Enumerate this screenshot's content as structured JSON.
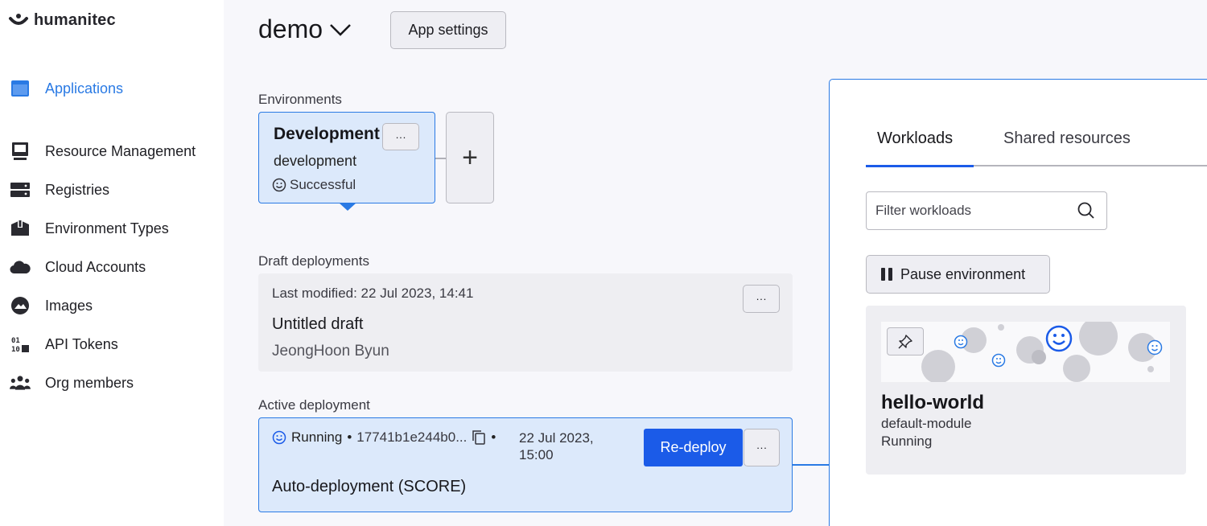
{
  "brand": {
    "name": "humanitec"
  },
  "sidebar": {
    "items": [
      {
        "label": "Applications",
        "icon": "applications-icon",
        "active": true
      },
      {
        "label": "Resource Management",
        "icon": "monitor-icon"
      },
      {
        "label": "Registries",
        "icon": "server-icon"
      },
      {
        "label": "Environment Types",
        "icon": "box-icon"
      },
      {
        "label": "Cloud Accounts",
        "icon": "cloud-icon"
      },
      {
        "label": "Images",
        "icon": "image-icon"
      },
      {
        "label": "API Tokens",
        "icon": "binary-icon"
      },
      {
        "label": "Org members",
        "icon": "people-icon"
      }
    ]
  },
  "header": {
    "app_name": "demo",
    "app_settings_label": "App settings"
  },
  "environments": {
    "label": "Environments",
    "card": {
      "name": "Development",
      "slug": "development",
      "status": "Successful",
      "more_label": "···"
    },
    "add_label": "+"
  },
  "draft": {
    "label": "Draft deployments",
    "last_modified": "Last modified: 22 Jul 2023, 14:41",
    "title": "Untitled draft",
    "author": "JeongHoon Byun",
    "more_label": "···"
  },
  "active": {
    "label": "Active deployment",
    "status": "Running",
    "hash": "17741b1e244b0...",
    "date_line1": "22 Jul 2023,",
    "date_line2": "15:00",
    "title": "Auto-deployment (SCORE)",
    "redeploy_label": "Re-deploy",
    "more_label": "···"
  },
  "panel": {
    "tabs": [
      {
        "label": "Workloads",
        "active": true
      },
      {
        "label": "Shared resources"
      }
    ],
    "filter_placeholder": "Filter workloads",
    "pause_label": "Pause environment",
    "workload": {
      "name": "hello-world",
      "module": "default-module",
      "status": "Running"
    }
  },
  "colors": {
    "accent": "#2a7ae4",
    "primary_button": "#1b5be8",
    "card_selected": "#dce9fb",
    "card_neutral": "#eeeef2"
  }
}
